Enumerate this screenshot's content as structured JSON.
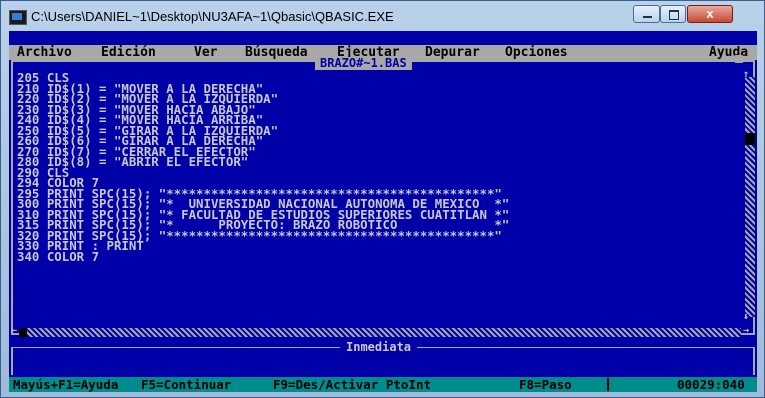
{
  "window": {
    "title": "C:\\Users\\DANIEL~1\\Desktop\\NU3AFA~1\\Qbasic\\QBASIC.EXE",
    "close_label": "x"
  },
  "menubar": {
    "items": [
      "Archivo",
      "Edición",
      "Ver",
      "Búsqueda",
      "Ejecutar",
      "Depurar",
      "Opciones",
      "Ayuda"
    ]
  },
  "editor": {
    "file_title": "BRAZO#~1.BAS",
    "arrow_up": "↑",
    "arrow_down": "↓",
    "arrow_left": "←",
    "arrow_right": "→",
    "lines": [
      "205 CLS",
      "210 ID$(1) = \"MOVER A LA DERECHA\"",
      "220 ID$(2) = \"MOVER A LA IZQUIERDA\"",
      "230 ID$(3) = \"MOVER HACIA ABAJO\"",
      "240 ID$(4) = \"MOVER HACIA ARRIBA\"",
      "250 ID$(5) = \"GIRAR A LA IZQUIERDA\"",
      "260 ID$(6) = \"GIRAR A LA DERECHA\"",
      "270 ID$(7) = \"CERRAR EL EFECTOR\"",
      "280 ID$(8) = \"ABRIR EL EFECTOR\"",
      "290 CLS",
      "294 COLOR 7",
      "295 PRINT SPC(15); \"********************************************\"",
      "300 PRINT SPC(15); \"*  UNIVERSIDAD NACIONAL AUTONOMA DE MEXICO  *\"",
      "310 PRINT SPC(15); \"* FACULTAD DE ESTUDIOS SUPERIORES CUATITLAN *\"",
      "315 PRINT SPC(15); \"*      PROYECTO: BRAZO ROBOTICO             *\"",
      "320 PRINT SPC(15); \"********************************************\"",
      "330 PRINT : PRINT",
      "340 COLOR 7"
    ]
  },
  "immediate": {
    "title": "Inmediata"
  },
  "statusbar": {
    "hints": [
      "Mayús+F1=Ayuda",
      "F5=Continuar",
      "F9=Des/Activar PtoInt",
      "F8=Paso"
    ],
    "position": "00029:040"
  }
}
